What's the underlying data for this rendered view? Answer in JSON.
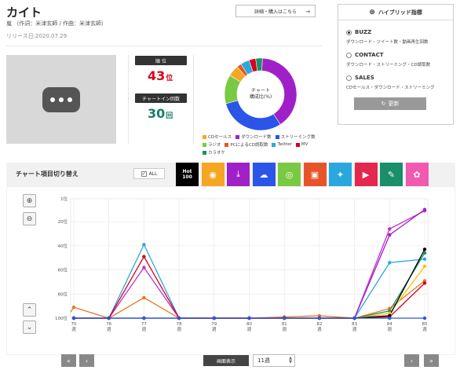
{
  "song": {
    "title": "カイト",
    "credits": "嵐 （作詞：米津玄師 / 作曲：米津玄師）",
    "release": "リリース日:2020.07.29",
    "buy_button": "詳細・購入はこちら"
  },
  "stats": {
    "rank_label": "順 位",
    "rank_value": "43",
    "rank_unit": "位",
    "chart_in_label": "チャートイン回数",
    "chart_in_value": "30",
    "chart_in_unit": "回",
    "rank_color": "#d9001b",
    "chart_in_color": "#1a7d6b"
  },
  "donut": {
    "center_line1": "チャート",
    "center_line2": "構成比(%)",
    "legend": [
      {
        "label": "CDセールス",
        "color": "#f5a623"
      },
      {
        "label": "ダウンロード数",
        "color": "#a020c8"
      },
      {
        "label": "ストリーミング数",
        "color": "#2b55e6"
      },
      {
        "label": "ラジオ",
        "color": "#7ac943"
      },
      {
        "label": "PCによるCD読取数",
        "color": "#e8542a"
      },
      {
        "label": "Twitter",
        "color": "#29a8e0"
      },
      {
        "label": "MV",
        "color": "#d6001c"
      },
      {
        "label": "カラオケ",
        "color": "#1a8f6a"
      }
    ]
  },
  "hybrid": {
    "title": "ハイブリッド指標",
    "options": [
      {
        "label": "BUZZ",
        "desc": "ダウンロード・ツイート数・動画再生回数",
        "selected": true
      },
      {
        "label": "CONTACT",
        "desc": "ダウンロード・ストリーミング・CD読取数",
        "selected": false
      },
      {
        "label": "SALES",
        "desc": "CDセールス・ダウンロード・ストリーミング",
        "selected": false
      }
    ],
    "update_button": "更新"
  },
  "chart_controls": {
    "title": "チャート項目切り替え",
    "all_label": "ALL",
    "tabs": [
      {
        "name": "hot100",
        "line1": "Hot",
        "line2": "100",
        "color": "#000000"
      },
      {
        "name": "cd-sales",
        "icon": "disc-icon",
        "color": "#f5a623"
      },
      {
        "name": "download",
        "icon": "download-icon",
        "color": "#a020c8"
      },
      {
        "name": "streaming",
        "icon": "cloud-icon",
        "color": "#2b55e6"
      },
      {
        "name": "radio",
        "icon": "radio-icon",
        "color": "#7ac943"
      },
      {
        "name": "pc-cd-read",
        "icon": "computer-icon",
        "color": "#e8542a"
      },
      {
        "name": "twitter",
        "icon": "twitter-icon",
        "color": "#29a8e0"
      },
      {
        "name": "mv",
        "icon": "play-icon",
        "color": "#e4274f"
      },
      {
        "name": "karaoke",
        "icon": "mic-icon",
        "color": "#1a8f6a"
      },
      {
        "name": "look",
        "icon": "look-icon",
        "color": "#f15ab0"
      }
    ]
  },
  "chart_data": {
    "type": "line",
    "x": [
      "75\n週",
      "76\n週",
      "77\n週",
      "78\n週",
      "79\n週",
      "80\n週",
      "81\n週",
      "82\n週",
      "83\n週",
      "84\n週",
      "85\n週"
    ],
    "x_labels": [
      "75",
      "76",
      "77",
      "78",
      "79",
      "80",
      "81",
      "82",
      "83",
      "84",
      "85"
    ],
    "x_unit": "週",
    "yticks": [
      "1位",
      "20位",
      "40位",
      "60位",
      "80位",
      "100位"
    ],
    "ylim": [
      1,
      100
    ],
    "y_reversed": true,
    "grid": true,
    "series": [
      {
        "color": "#e87722",
        "values": [
          95,
          91,
          100,
          83,
          100,
          100,
          100,
          99,
          98,
          100,
          92,
          69
        ]
      },
      {
        "color": "#29a8e0",
        "values": [
          null,
          100,
          100,
          39,
          100,
          100,
          100,
          100,
          100,
          100,
          54,
          51
        ]
      },
      {
        "color": "#c030d0",
        "values": [
          null,
          100,
          100,
          58,
          100,
          100,
          100,
          100,
          100,
          100,
          26,
          11
        ]
      },
      {
        "color": "#a020c8",
        "values": [
          null,
          null,
          null,
          null,
          null,
          null,
          null,
          null,
          null,
          100,
          31,
          10
        ]
      },
      {
        "color": "#d6001c",
        "values": [
          null,
          100,
          100,
          49,
          100,
          100,
          100,
          100,
          100,
          100,
          99,
          71
        ]
      },
      {
        "color": "#1a8f6a",
        "values": [
          null,
          null,
          null,
          null,
          null,
          null,
          null,
          null,
          null,
          100,
          94,
          46
        ]
      },
      {
        "color": "#f5c400",
        "values": [
          null,
          null,
          null,
          null,
          null,
          null,
          null,
          null,
          null,
          100,
          96,
          57
        ]
      },
      {
        "color": "#000000",
        "values": [
          null,
          100,
          100,
          100,
          100,
          100,
          100,
          100,
          100,
          100,
          98,
          43
        ]
      },
      {
        "color": "#2b55e6",
        "values": [
          null,
          100,
          100,
          100,
          100,
          100,
          100,
          100,
          100,
          100,
          100,
          100
        ]
      }
    ]
  },
  "footer": {
    "period_label": "画面表示",
    "period_value": "11週"
  }
}
